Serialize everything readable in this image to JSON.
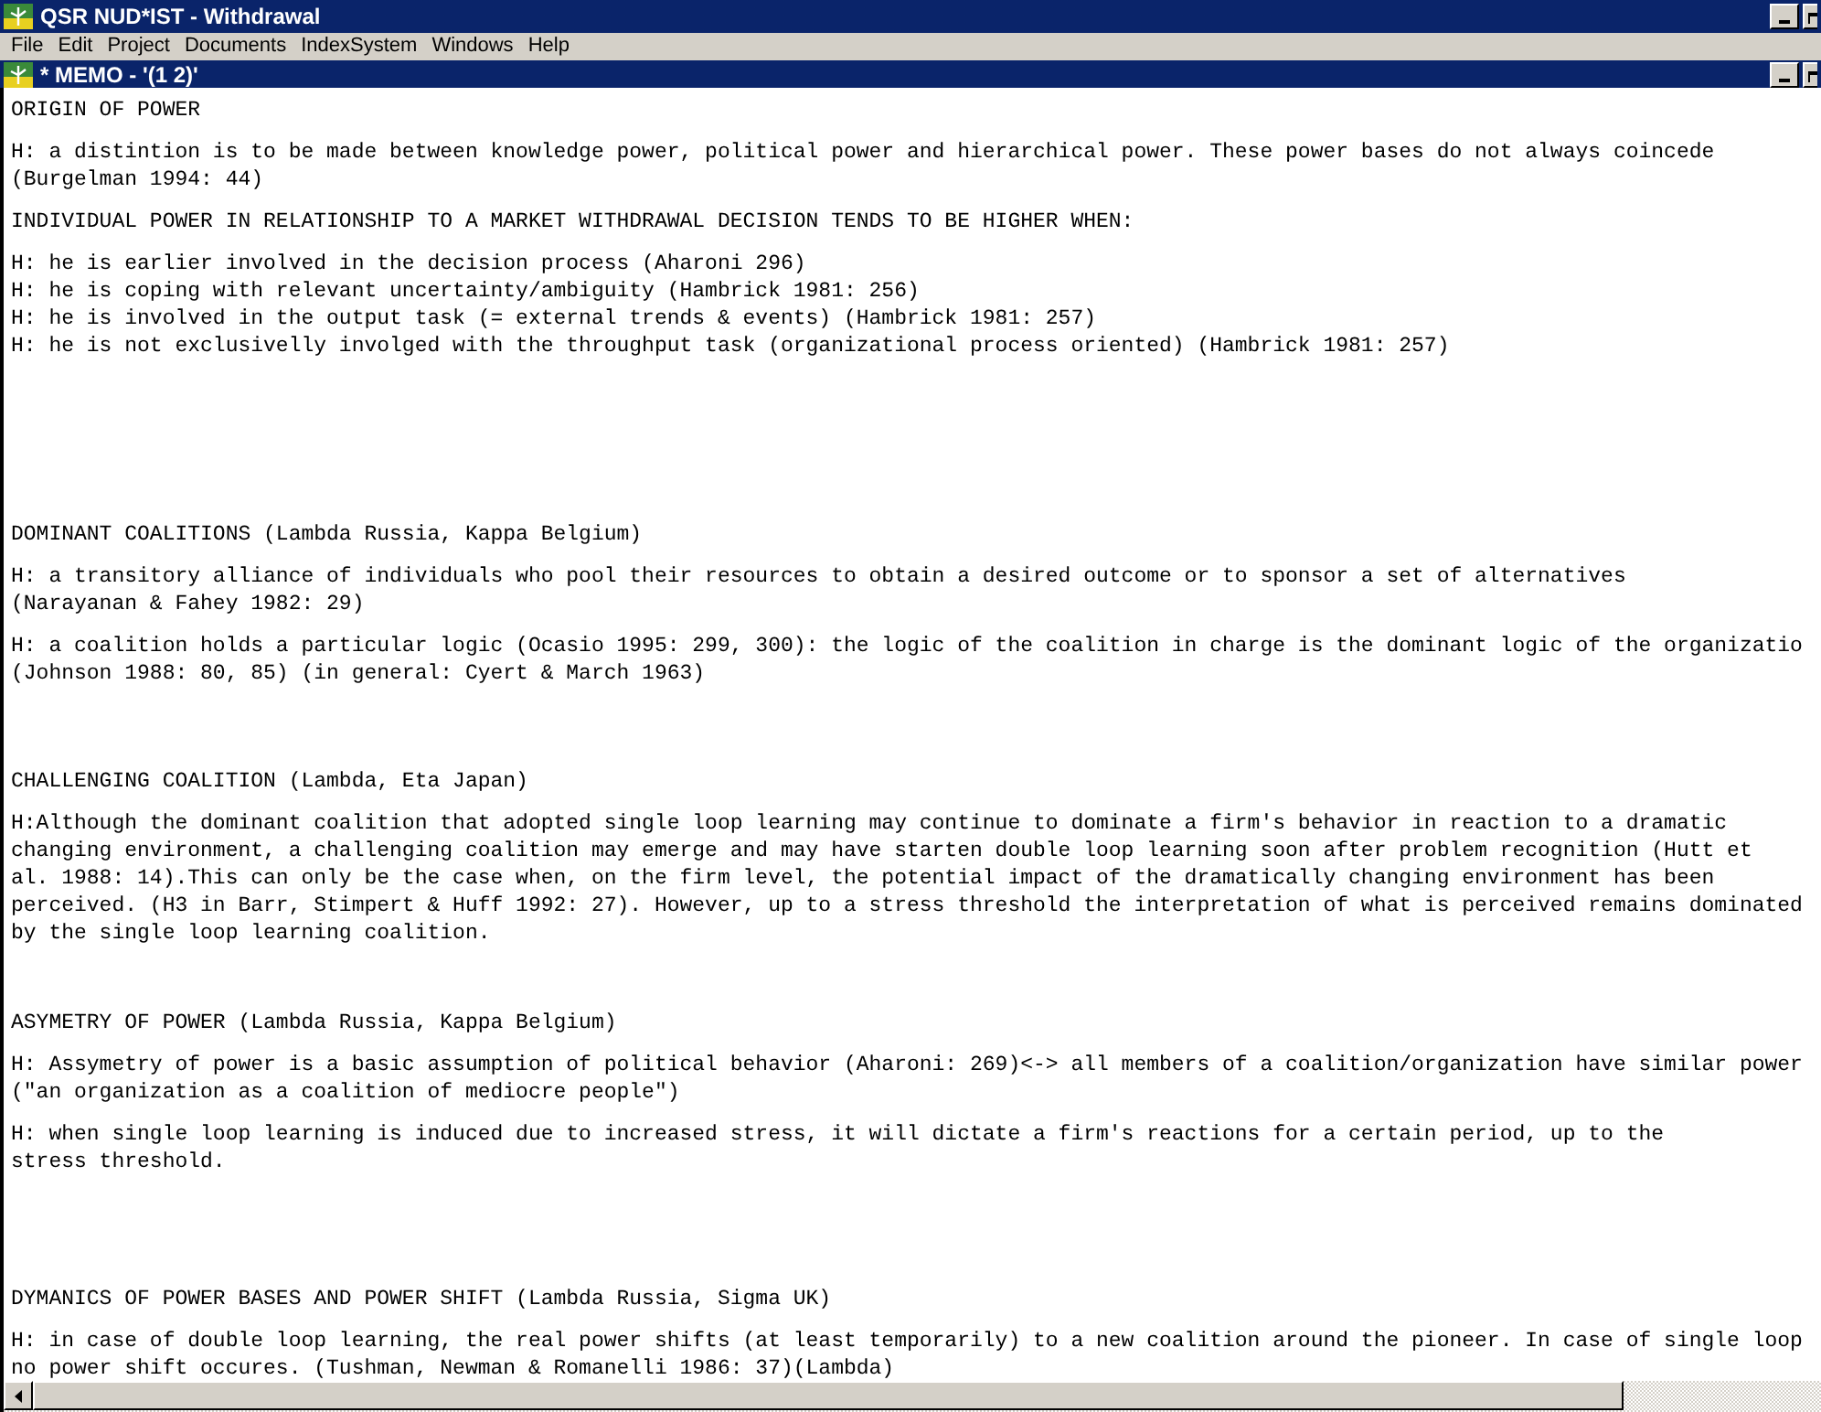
{
  "window": {
    "title": "QSR NUD*IST - Withdrawal"
  },
  "menu": [
    "File",
    "Edit",
    "Project",
    "Documents",
    "IndexSystem",
    "Windows",
    "Help"
  ],
  "memo": {
    "title": "* MEMO - '(1 2)'",
    "blocks": [
      {
        "lines": [
          "ORIGIN OF POWER"
        ]
      },
      {
        "lines": [
          "H: a distintion is to be made between knowledge power, political power and hierarchical power. These power bases do not always coincede",
          "(Burgelman 1994: 44)"
        ]
      },
      {
        "lines": [
          "INDIVIDUAL POWER IN RELATIONSHIP TO A MARKET WITHDRAWAL DECISION TENDS TO BE HIGHER WHEN:"
        ]
      },
      {
        "lines": [
          "H: he is earlier involved in the decision process (Aharoni 296)",
          "H: he is coping with relevant uncertainty/ambiguity (Hambrick 1981: 256)",
          "H: he is involved in the output task (= external trends & events) (Hambrick 1981: 257)",
          "H: he is not exclusivelly involged with the throughput task (organizational process oriented) (Hambrick 1981: 257)"
        ]
      },
      {
        "lines": [
          "DOMINANT COALITIONS (Lambda Russia, Kappa Belgium)"
        ]
      },
      {
        "lines": [
          "H: a transitory alliance of individuals who pool their resources to obtain a desired outcome or to sponsor a set of alternatives",
          "(Narayanan & Fahey 1982: 29)"
        ]
      },
      {
        "lines": [
          "H: a coalition holds a particular logic (Ocasio 1995: 299, 300): the logic of the coalition in charge is the dominant logic of the organizatio",
          "(Johnson 1988: 80, 85) (in general: Cyert & March 1963)"
        ]
      },
      {
        "lines": [
          "CHALLENGING COALITION (Lambda, Eta Japan)"
        ]
      },
      {
        "lines": [
          "H:Although the dominant coalition that adopted single loop learning may continue to dominate a firm's behavior in reaction to a dramatic",
          "changing environment, a challenging coalition may emerge and may have starten double loop learning soon after problem recognition (Hutt et",
          "al. 1988: 14).This can only be the case when, on the firm level, the potential impact of the dramatically changing environment has been",
          "perceived. (H3 in Barr, Stimpert & Huff 1992: 27). However, up to a stress threshold the interpretation of what is perceived remains dominated",
          "by the single loop learning coalition."
        ]
      },
      {
        "lines": [
          "ASYMETRY OF POWER (Lambda Russia, Kappa Belgium)"
        ]
      },
      {
        "lines": [
          "H: Assymetry of power is a basic assumption of political behavior (Aharoni: 269)<-> all members of a coalition/organization have similar power",
          "(\"an organization as a coalition of mediocre people\")"
        ]
      },
      {
        "lines": [
          "H: when single loop learning is induced due to increased stress, it will dictate a firm's reactions for a certain period, up to the",
          "stress threshold."
        ]
      },
      {
        "lines": [
          "DYMANICS OF POWER BASES AND POWER SHIFT (Lambda Russia, Sigma UK)"
        ]
      },
      {
        "lines": [
          "H: in case of double loop learning, the real power shifts (at least temporarily) to a new coalition around the pioneer. In case of single loop",
          "no power shift occures. (Tushman, Newman & Romanelli 1986: 37)(Lambda)"
        ]
      }
    ]
  }
}
